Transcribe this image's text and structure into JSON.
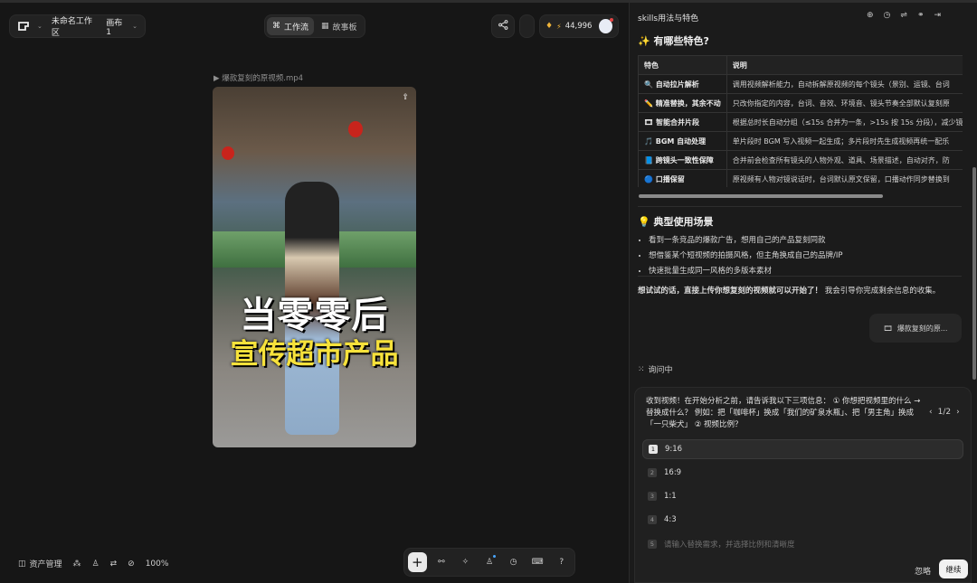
{
  "workspace": {
    "name": "未命名工作区",
    "canvas": "画布 1"
  },
  "tabs": [
    {
      "label": "工作流"
    },
    {
      "label": "故事板"
    }
  ],
  "credits": {
    "value": "44,996"
  },
  "video": {
    "filename": "爆款复刻的原视频.mp4",
    "caption_line1": "当零零后",
    "caption_line2": "宣传超市产品"
  },
  "bottom": {
    "assets_label": "资产管理",
    "zoom": "100%"
  },
  "panel": {
    "title": "skills用法与特色",
    "features_heading": "✨ 有哪些特色?",
    "table": {
      "headers": [
        "特色",
        "说明"
      ],
      "rows": [
        {
          "icon": "🔍",
          "feature": "自动拉片解析",
          "desc": "调用视频解析能力，自动拆解原视频的每个镜头（景别、运镜、台词"
        },
        {
          "icon": "✏️",
          "feature": "精准替换，其余不动",
          "desc": "只改你指定的内容，台词、音效、环境音、镜头节奏全部默认复刻原"
        },
        {
          "icon": "🎞",
          "feature": "智能合并片段",
          "desc": "根据总时长自动分组（≤15s 合并为一条，>15s 按 15s 分段），减少镜"
        },
        {
          "icon": "🎵",
          "feature": "BGM 自动处理",
          "desc": "单片段时 BGM 写入视频一起生成；多片段时先生成视频再统一配乐"
        },
        {
          "icon": "📘",
          "feature": "跨镜头一致性保障",
          "desc": "合并前会检查所有镜头的人物外观、道具、场景描述，自动对齐，防"
        },
        {
          "icon": "🔵",
          "feature": "口播保留",
          "desc": "原视频有人物对镜说话时，台词默认原文保留，口播动作同步替换到"
        }
      ]
    },
    "scenarios_heading": "💡 典型使用场景",
    "scenarios": [
      "看到一条竞品的爆款广告，想用自己的产品复刻同款",
      "想借鉴某个短视频的拍摄风格，但主角换成自己的品牌/IP",
      "快速批量生成同一风格的多版本素材"
    ],
    "cta_bold": "想试试的话，直接上传你想复刻的视频就可以开始了！",
    "cta_rest": " 我会引导你完成剩余信息的收集。",
    "attachment_chip": "爆款复刻的原...",
    "status": "询问中"
  },
  "question": {
    "text": "收到视频！在开始分析之前，请告诉我以下三项信息：  ① 你想把视频里的什么 → 替换成什么？ 例如：把「咖啡杯」换成「我们的矿泉水瓶」、把「男主角」换成「一只柴犬」 ② 视频比例？",
    "pager": "1/2",
    "options": [
      {
        "num": "1",
        "label": "9:16"
      },
      {
        "num": "2",
        "label": "16:9"
      },
      {
        "num": "3",
        "label": "1:1"
      },
      {
        "num": "4",
        "label": "4:3"
      },
      {
        "num": "5",
        "label": "请输入替换需求，并选择比例和清晰度"
      }
    ],
    "ignore_label": "忽略",
    "continue_label": "继续"
  }
}
